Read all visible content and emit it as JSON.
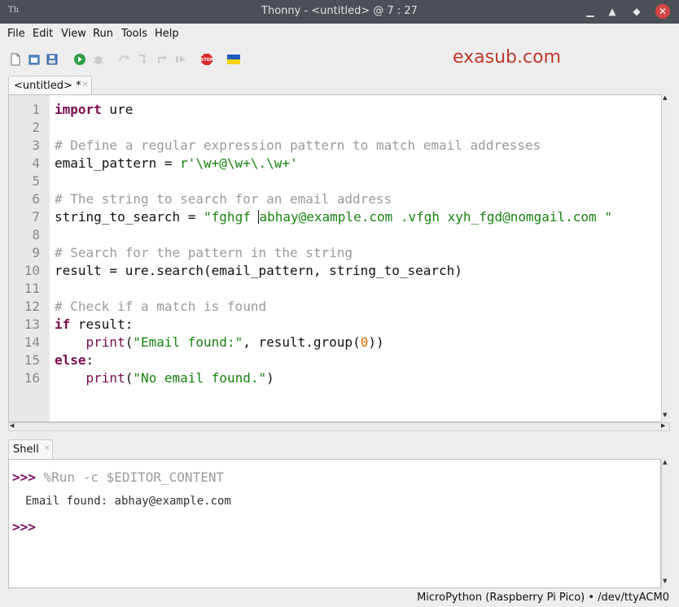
{
  "window": {
    "app_icon": "Th",
    "title": "Thonny  -  <untitled>  @  7 : 27",
    "controls": [
      "minimize-icon",
      "maximize-icon",
      "restore-icon",
      "close-icon"
    ]
  },
  "menu": {
    "items": [
      "File",
      "Edit",
      "View",
      "Run",
      "Tools",
      "Help"
    ]
  },
  "toolbar": {
    "buttons": [
      "new-file",
      "open-file",
      "save-file",
      "run",
      "debug",
      "step-over",
      "step-into",
      "step-out",
      "resume",
      "stop",
      "ukraine-flag"
    ],
    "watermark": "exasub.com"
  },
  "editor": {
    "tab_label": "<untitled> *",
    "tab_close": "×",
    "line_numbers": [
      "1",
      "2",
      "3",
      "4",
      "5",
      "6",
      "7",
      "8",
      "9",
      "10",
      "11",
      "12",
      "13",
      "14",
      "15",
      "16"
    ],
    "code": {
      "l1_kw": "import",
      "l1_rest": " ure",
      "l3": "# Define a regular expression pattern to match email addresses",
      "l4_a": "email_pattern = ",
      "l4_str": "r'\\w+@\\w+\\.\\w+'",
      "l6": "# The string to search for an email address",
      "l7_a": "string_to_search = ",
      "l7_str1": "\"fghgf ",
      "l7_str2": "abhay@example.com .vfgh xyh_fgd@nomgail.com \"",
      "l9": "# Search for the pattern in the string",
      "l10": "result = ure.search(email_pattern, string_to_search)",
      "l12": "# Check if a match is found",
      "l13_kw": "if",
      "l13_rest": " result:",
      "l14_indent": "    ",
      "l14_fn": "print",
      "l14_p1": "(",
      "l14_str": "\"Email found:\"",
      "l14_mid": ", result.group(",
      "l14_num": "0",
      "l14_end": "))",
      "l15_kw": "else",
      "l15_rest": ":",
      "l16_indent": "    ",
      "l16_fn": "print",
      "l16_p1": "(",
      "l16_str": "\"No email found.\"",
      "l16_end": ")"
    }
  },
  "shell": {
    "tab_label": "Shell",
    "tab_close": "×",
    "prompt": ">>>",
    "command": " %Run -c $EDITOR_CONTENT",
    "output": "Email found: abhay@example.com"
  },
  "status": {
    "text": "MicroPython (Raspberry Pi Pico)  •  /dev/ttyACM0"
  }
}
